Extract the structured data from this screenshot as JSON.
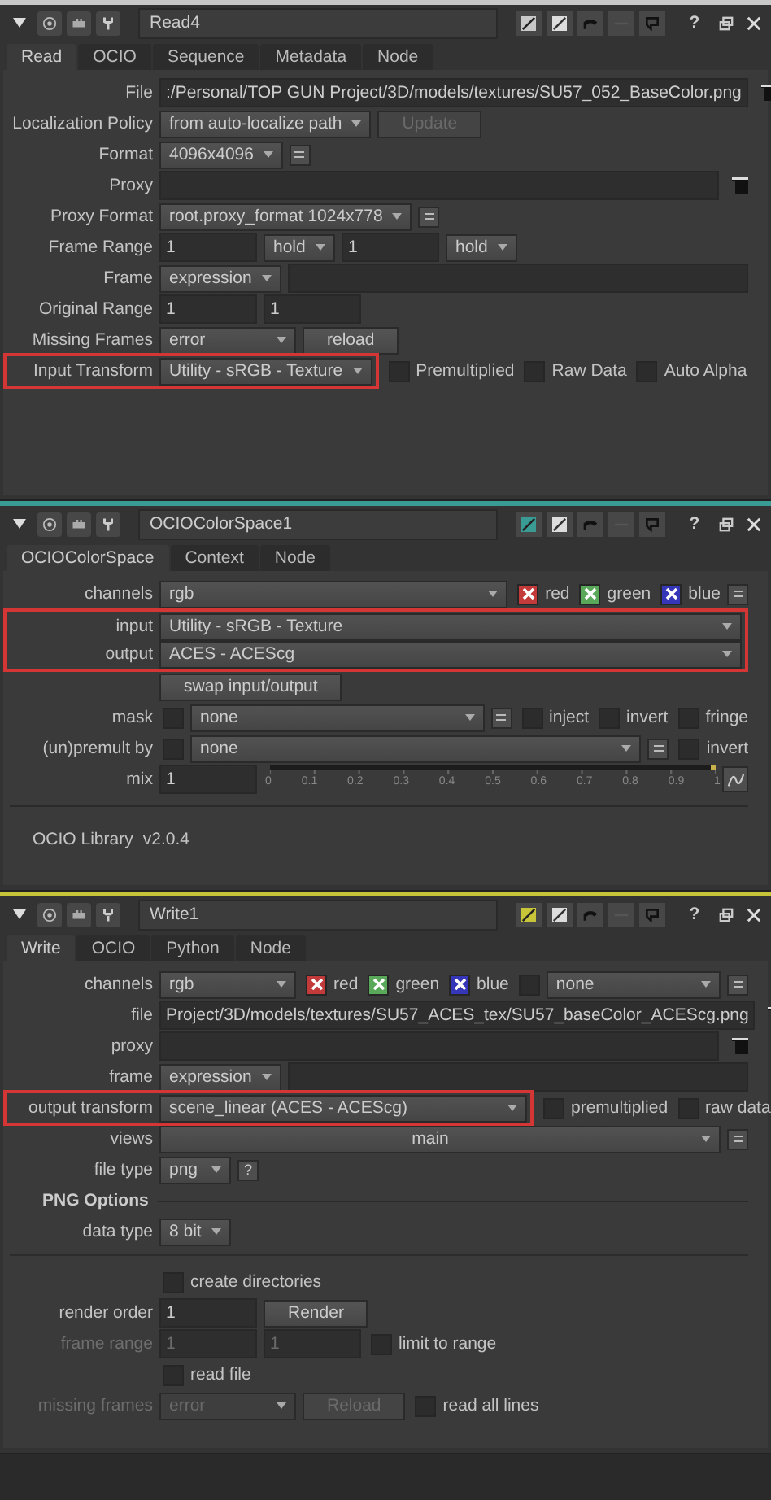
{
  "panels": [
    {
      "title": "Read4",
      "color": "#c8c8c8",
      "help": "?",
      "tabs": [
        {
          "label": "Read",
          "selected": true
        },
        {
          "label": "OCIO",
          "selected": false
        },
        {
          "label": "Sequence",
          "selected": false
        },
        {
          "label": "Metadata",
          "selected": false
        },
        {
          "label": "Node",
          "selected": false
        }
      ],
      "rows": [
        {
          "kind": "controls",
          "label": "File",
          "widgets": [
            {
              "kind": "field",
              "value": ":/Personal/TOP GUN Project/3D/models/textures/SU57_052_BaseColor.png",
              "grow": true
            },
            {
              "kind": "folder"
            }
          ]
        },
        {
          "kind": "controls",
          "label": "Localization Policy",
          "widgets": [
            {
              "kind": "dropdown",
              "value": "from auto-localize path"
            },
            {
              "kind": "button",
              "label": "Update",
              "disabled": true
            }
          ]
        },
        {
          "kind": "controls",
          "label": "Format",
          "widgets": [
            {
              "kind": "dropdown",
              "value": "4096x4096"
            },
            {
              "kind": "eq"
            }
          ]
        },
        {
          "kind": "controls",
          "label": "Proxy",
          "widgets": [
            {
              "kind": "field",
              "grow": true
            },
            {
              "kind": "folder"
            }
          ]
        },
        {
          "kind": "controls",
          "label": "Proxy Format",
          "widgets": [
            {
              "kind": "dropdown",
              "value": "root.proxy_format 1024x778"
            },
            {
              "kind": "eq"
            }
          ]
        },
        {
          "kind": "controls",
          "label": "Frame Range",
          "widgets": [
            {
              "kind": "field",
              "value": "1"
            },
            {
              "kind": "dropdown",
              "value": "hold"
            },
            {
              "kind": "field",
              "value": "1"
            },
            {
              "kind": "dropdown",
              "value": "hold"
            }
          ]
        },
        {
          "kind": "controls",
          "label": "Frame",
          "widgets": [
            {
              "kind": "dropdown",
              "value": "expression"
            },
            {
              "kind": "field",
              "grow": true
            }
          ]
        },
        {
          "kind": "controls",
          "label": "Original Range",
          "widgets": [
            {
              "kind": "field",
              "value": "1"
            },
            {
              "kind": "field",
              "value": "1"
            }
          ]
        },
        {
          "kind": "controls",
          "label": "Missing Frames",
          "widgets": [
            {
              "kind": "dropdown",
              "value": "error",
              "wide": true
            },
            {
              "kind": "button",
              "label": "reload"
            }
          ]
        },
        {
          "kind": "controls",
          "label": "Input Transform",
          "highlight": true,
          "widgets": [
            {
              "kind": "dropdown",
              "value": "Utility - sRGB - Texture"
            },
            {
              "kind": "checkbox",
              "label": "Premultiplied",
              "checked": false
            },
            {
              "kind": "checkbox",
              "label": "Raw Data",
              "checked": false
            },
            {
              "kind": "checkbox",
              "label": "Auto Alpha",
              "checked": false
            }
          ]
        }
      ]
    },
    {
      "title": "OCIOColorSpace1",
      "color": "#3a9a94",
      "help": "?",
      "tabs": [
        {
          "label": "OCIOColorSpace",
          "selected": true
        },
        {
          "label": "Context",
          "selected": false
        },
        {
          "label": "Node",
          "selected": false
        }
      ],
      "rows": [
        {
          "kind": "controls",
          "label": "channels",
          "widgets": [
            {
              "kind": "dropdown",
              "value": "rgb",
              "grow": true
            },
            {
              "kind": "checkbox",
              "label": "red",
              "checked": true,
              "color": "#c23a3a"
            },
            {
              "kind": "checkbox",
              "label": "green",
              "checked": true,
              "color": "#5aa85a"
            },
            {
              "kind": "checkbox",
              "label": "blue",
              "checked": true,
              "color": "#3636b8"
            },
            {
              "kind": "eq"
            }
          ]
        },
        {
          "kind": "controls",
          "label": "input",
          "highlight": true,
          "widgets": [
            {
              "kind": "dropdown",
              "value": "Utility - sRGB - Texture",
              "grow": true
            }
          ]
        },
        {
          "kind": "controls",
          "label": "output",
          "highlight": true,
          "widgets": [
            {
              "kind": "dropdown",
              "value": "ACES - ACEScg",
              "grow": true
            }
          ]
        },
        {
          "kind": "controls",
          "widgets": [
            {
              "kind": "button",
              "label": "swap input/output"
            }
          ]
        },
        {
          "kind": "controls",
          "label": "mask",
          "widgets": [
            {
              "kind": "checkbox",
              "checked": false
            },
            {
              "kind": "dropdown",
              "value": "none",
              "grow": true
            },
            {
              "kind": "eq"
            },
            {
              "kind": "checkbox",
              "label": "inject",
              "checked": false
            },
            {
              "kind": "checkbox",
              "label": "invert",
              "checked": false
            },
            {
              "kind": "checkbox",
              "label": "fringe",
              "checked": false
            }
          ]
        },
        {
          "kind": "controls",
          "label": "(un)premult by",
          "widgets": [
            {
              "kind": "checkbox",
              "checked": false
            },
            {
              "kind": "dropdown",
              "value": "none",
              "grow": true
            },
            {
              "kind": "eq"
            },
            {
              "kind": "checkbox",
              "label": "invert",
              "checked": false
            }
          ]
        },
        {
          "kind": "controls",
          "label": "mix",
          "widgets": [
            {
              "kind": "field",
              "value": "1"
            },
            {
              "kind": "slider",
              "level": 1,
              "ticks": [
                "0",
                "0.1",
                "0.2",
                "0.3",
                "0.4",
                "0.5",
                "0.6",
                "0.7",
                "0.8",
                "0.9",
                "1"
              ]
            },
            {
              "kind": "curve"
            }
          ]
        },
        {
          "kind": "note",
          "label": "OCIO Library",
          "value": "v2.0.4"
        }
      ]
    },
    {
      "title": "Write1",
      "color": "#c8c43a",
      "help": "?",
      "tabs": [
        {
          "label": "Write",
          "selected": true
        },
        {
          "label": "OCIO",
          "selected": false
        },
        {
          "label": "Python",
          "selected": false
        },
        {
          "label": "Node",
          "selected": false
        }
      ],
      "rows": [
        {
          "kind": "controls",
          "label": "channels",
          "widgets": [
            {
              "kind": "dropdown",
              "value": "rgb",
              "wide": true
            },
            {
              "kind": "checkbox",
              "label": "red",
              "checked": true,
              "color": "#c23a3a"
            },
            {
              "kind": "checkbox",
              "label": "green",
              "checked": true,
              "color": "#5aa85a"
            },
            {
              "kind": "checkbox",
              "label": "blue",
              "checked": true,
              "color": "#3636b8"
            },
            {
              "kind": "checkbox",
              "checked": false
            },
            {
              "kind": "dropdown",
              "value": "none",
              "grow": true
            },
            {
              "kind": "eq"
            }
          ]
        },
        {
          "kind": "controls",
          "label": "file",
          "widgets": [
            {
              "kind": "field",
              "value": "Project/3D/models/textures/SU57_ACES_tex/SU57_baseColor_ACEScg.png",
              "grow": true
            },
            {
              "kind": "folder"
            }
          ]
        },
        {
          "kind": "controls",
          "label": "proxy",
          "widgets": [
            {
              "kind": "field",
              "grow": true
            },
            {
              "kind": "folder"
            }
          ]
        },
        {
          "kind": "controls",
          "label": "frame",
          "widgets": [
            {
              "kind": "dropdown",
              "value": "expression"
            },
            {
              "kind": "field",
              "grow": true
            }
          ]
        },
        {
          "kind": "controls",
          "label": "output transform",
          "highlight": true,
          "widgets": [
            {
              "kind": "dropdown",
              "value": "scene_linear (ACES - ACEScg)",
              "xwide": true
            },
            {
              "kind": "checkbox",
              "label": "premultiplied",
              "checked": false
            },
            {
              "kind": "checkbox",
              "label": "raw data",
              "checked": false
            }
          ]
        },
        {
          "kind": "controls",
          "label": "views",
          "widgets": [
            {
              "kind": "dropdown",
              "value": "main",
              "grow": true,
              "centered": true
            },
            {
              "kind": "eq"
            }
          ]
        },
        {
          "kind": "controls",
          "label": "file type",
          "widgets": [
            {
              "kind": "dropdown",
              "value": "png"
            },
            {
              "kind": "help",
              "label": "?"
            }
          ]
        },
        {
          "kind": "section",
          "label": "PNG Options"
        },
        {
          "kind": "controls",
          "label": "data type",
          "widgets": [
            {
              "kind": "dropdown",
              "value": "8 bit"
            }
          ]
        },
        {
          "kind": "rule"
        },
        {
          "kind": "controls",
          "widgets": [
            {
              "kind": "checkbox",
              "label": "create directories",
              "checked": false
            }
          ]
        },
        {
          "kind": "controls",
          "label": "render order",
          "widgets": [
            {
              "kind": "field",
              "value": "1"
            },
            {
              "kind": "button",
              "label": "Render"
            }
          ]
        },
        {
          "kind": "controls",
          "label": "frame range",
          "disabled": true,
          "widgets": [
            {
              "kind": "field",
              "value": "1",
              "disabled": true
            },
            {
              "kind": "field",
              "value": "1",
              "disabled": true
            },
            {
              "kind": "checkbox",
              "label": "limit to range",
              "checked": false
            }
          ]
        },
        {
          "kind": "controls",
          "widgets": [
            {
              "kind": "checkbox",
              "label": "read file",
              "checked": false
            }
          ]
        },
        {
          "kind": "controls",
          "label": "missing frames",
          "disabled": true,
          "widgets": [
            {
              "kind": "dropdown",
              "value": "error",
              "wide": true,
              "disabled": true
            },
            {
              "kind": "button",
              "label": "Reload",
              "disabled": true
            },
            {
              "kind": "checkbox",
              "label": "read all lines",
              "checked": false
            }
          ]
        }
      ]
    }
  ]
}
